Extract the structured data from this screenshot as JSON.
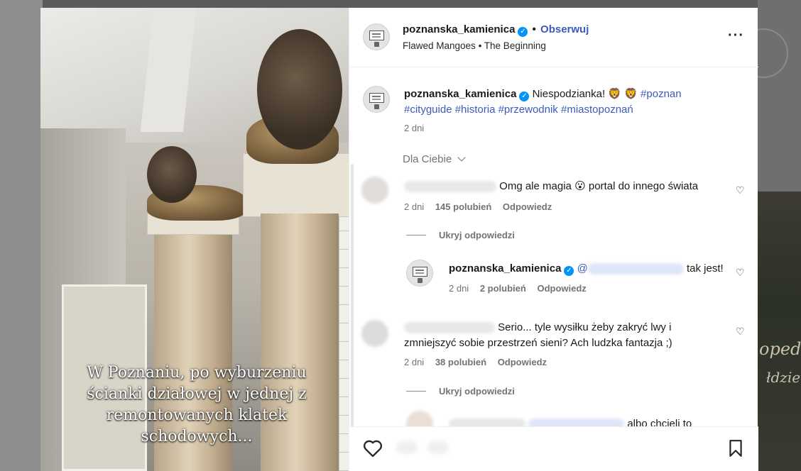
{
  "post": {
    "author": "poznanska_kamienica",
    "follow_label": "Obserwuj",
    "music": {
      "artist": "Flawed Mangoes",
      "track": "The Beginning"
    },
    "caption_text": "Niespodzianka!",
    "hashtags": [
      "#poznan",
      "#cityguide",
      "#historia",
      "#przewodnik",
      "#miastopoznań"
    ],
    "time": "2 dni",
    "overlay_caption": [
      "W Poznaniu, po wyburzeniu",
      "ścianki działowej w jednej z",
      "remontowanych klatek",
      "schodowych..."
    ]
  },
  "sort_label": "Dla Ciebie",
  "comments": [
    {
      "text_before": "Omg ale magia",
      "text_after": "portal do innego świata",
      "time": "2 dni",
      "likes": "145 polubień",
      "reply_label": "Odpowiedz",
      "toggle_label": "Ukryj odpowiedzi",
      "replies": [
        {
          "author": "poznanska_kamienica",
          "mention_prefix": "@",
          "text": "tak jest!",
          "time": "2 dni",
          "likes": "2 polubień",
          "reply_label": "Odpowiedz"
        }
      ]
    },
    {
      "text_line1": "Serio... tyle wysiłku żeby zakryć lwy i",
      "text_line2": "zmniejszyć sobie przestrzeń sieni? Ach ludzka fantazja ;)",
      "time": "2 dni",
      "likes": "38 polubień",
      "reply_label": "Odpowiedz",
      "toggle_label": "Ukryj odpowiedzi",
      "partial_reply_text": "albo chcieli to"
    }
  ],
  "background_text": [
    "oped",
    "łdzie"
  ],
  "colors": {
    "accent": "#3b5bbd",
    "verified": "#0095f6",
    "muted": "#737373"
  },
  "icons": [
    "verified-badge-icon",
    "more-options-icon",
    "chevron-down-icon",
    "heart-icon",
    "bookmark-icon",
    "lion-emoji-icon",
    "shocked-emoji-icon"
  ]
}
